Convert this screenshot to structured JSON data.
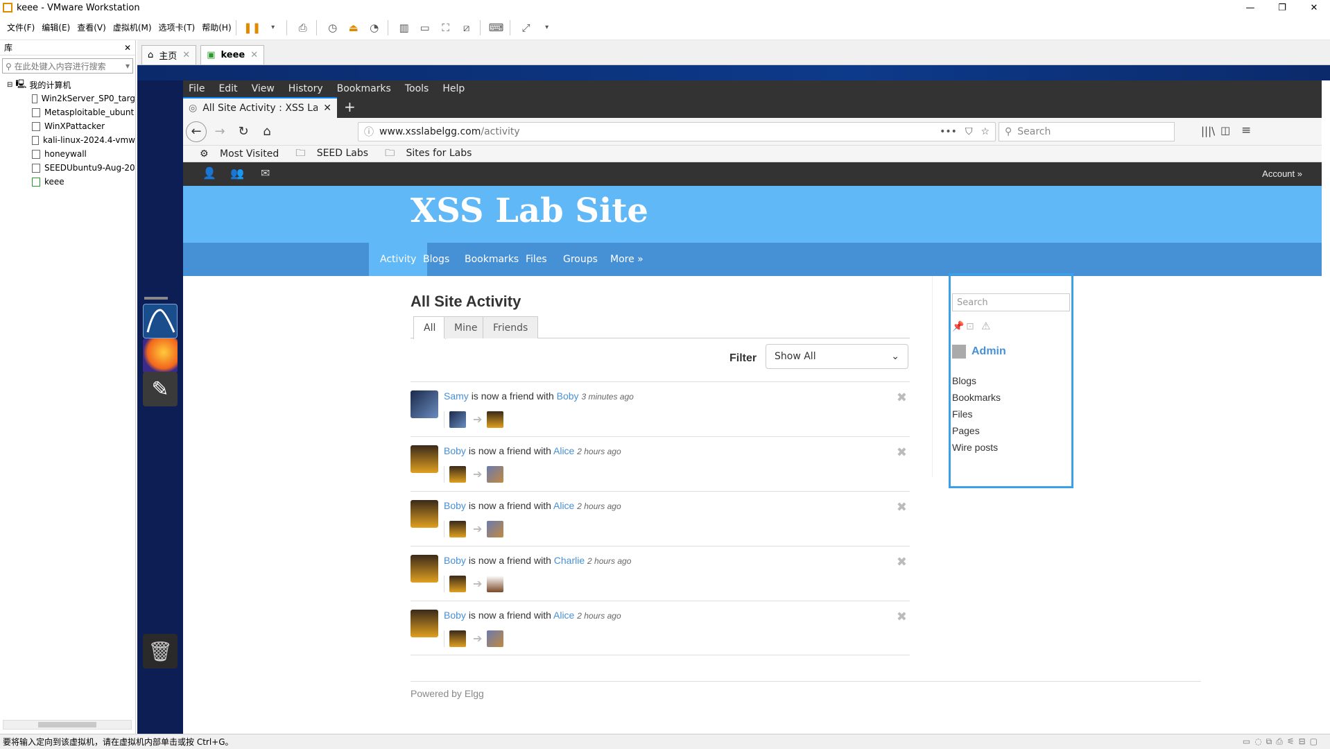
{
  "window": {
    "title": "keee - VMware Workstation"
  },
  "menubar": {
    "items": [
      "文件(F)",
      "编辑(E)",
      "查看(V)",
      "虚拟机(M)",
      "选项卡(T)",
      "帮助(H)"
    ]
  },
  "library": {
    "title": "库",
    "search_placeholder": "在此处键入内容进行搜索",
    "root": "我的计算机",
    "vms": [
      "Win2kServer_SP0_targ",
      "Metasploitable_ubunt",
      "WinXPattacker",
      "kali-linux-2024.4-vmw",
      "honeywall",
      "SEEDUbuntu9-Aug-20",
      "keee"
    ]
  },
  "vm_tabs": [
    {
      "label": "主页"
    },
    {
      "label": "keee"
    }
  ],
  "status_bar": {
    "text": "要将输入定向到该虚拟机，请在虚拟机内部单击或按 Ctrl+G。"
  },
  "firefox": {
    "menu": [
      "File",
      "Edit",
      "View",
      "History",
      "Bookmarks",
      "Tools",
      "Help"
    ],
    "tab_title": "All Site Activity : XSS Lab",
    "url_domain": "www.xsslabelgg.com",
    "url_path": "/activity",
    "search_placeholder": "Search",
    "bookmarks": [
      "Most Visited",
      "SEED Labs",
      "Sites for Labs"
    ]
  },
  "elgg": {
    "account": "Account »",
    "site_title": "XSS Lab Site",
    "nav": [
      "Activity",
      "Blogs",
      "Bookmarks",
      "Files",
      "Groups",
      "More »"
    ],
    "page_title": "All Site Activity",
    "tabs": [
      "All",
      "Mine",
      "Friends"
    ],
    "filter_label": "Filter",
    "filter_value": "Show All",
    "activity": [
      {
        "subject": "Samy",
        "verb": "is now a friend with",
        "object": "Boby",
        "time": "3 minutes ago"
      },
      {
        "subject": "Boby",
        "verb": "is now a friend with",
        "object": "Alice",
        "time": "2 hours ago"
      },
      {
        "subject": "Boby",
        "verb": "is now a friend with",
        "object": "Alice",
        "time": "2 hours ago"
      },
      {
        "subject": "Boby",
        "verb": "is now a friend with",
        "object": "Charlie",
        "time": "2 hours ago"
      },
      {
        "subject": "Boby",
        "verb": "is now a friend with",
        "object": "Alice",
        "time": "2 hours ago"
      }
    ],
    "footer": "Powered by Elgg",
    "sidebar": {
      "search_placeholder": "Search",
      "owner": "Admin",
      "links": [
        "Blogs",
        "Bookmarks",
        "Files",
        "Pages",
        "Wire posts"
      ]
    }
  },
  "colors": {
    "elgg_header": "#60b8f7",
    "elgg_nav": "#4690d6",
    "link": "#4690d6",
    "topbar": "#333333"
  }
}
